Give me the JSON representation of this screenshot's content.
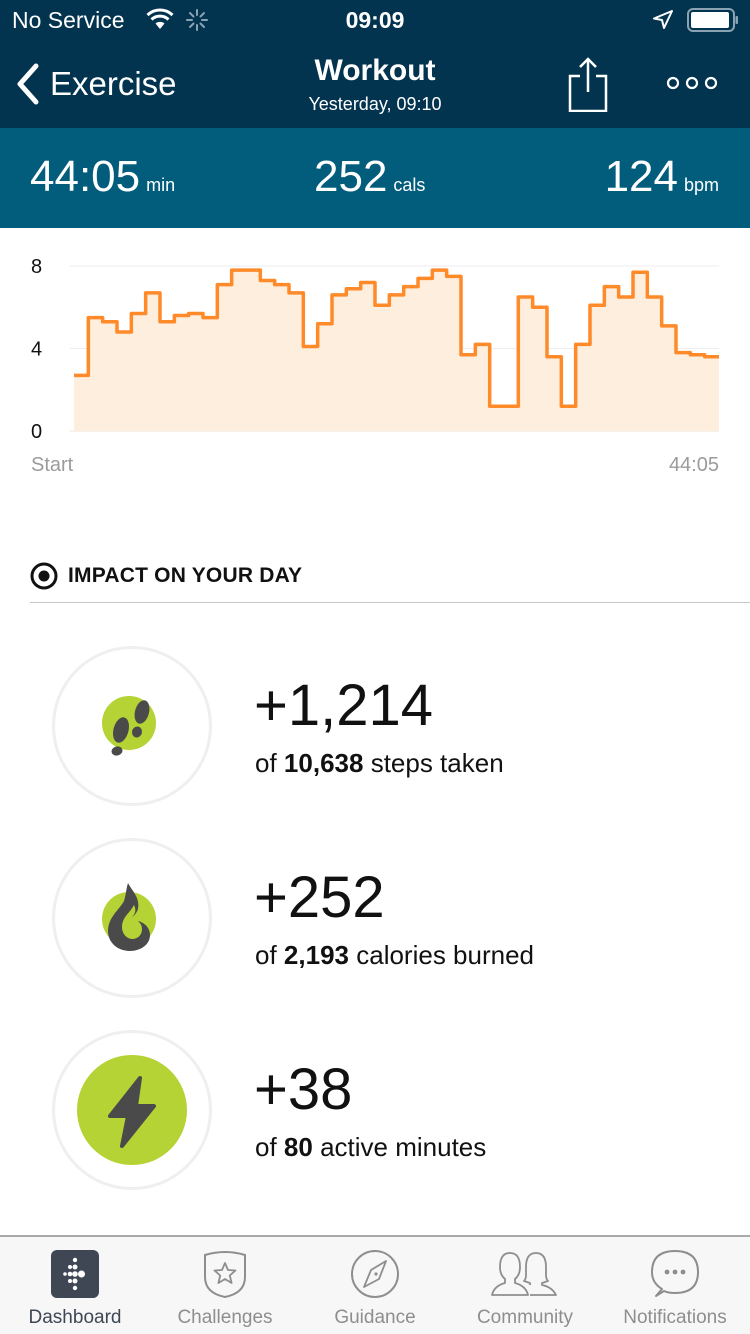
{
  "status_bar": {
    "carrier": "No Service",
    "time": "09:09",
    "icons": [
      "wifi-icon",
      "activity-spinner-icon",
      "location-arrow-icon",
      "battery-icon"
    ]
  },
  "nav": {
    "back_label": "Exercise",
    "title": "Workout",
    "subtitle": "Yesterday, 09:10",
    "share_icon": "share-icon",
    "more_icon": "more-dots-icon"
  },
  "summary": {
    "duration": {
      "value": "44:05",
      "unit": "min"
    },
    "calories": {
      "value": "252",
      "unit": "cals"
    },
    "heart_rate": {
      "value": "124",
      "unit": "bpm"
    }
  },
  "colors": {
    "nav_bg": "#02334f",
    "summary_bg": "#025d7c",
    "chart_line": "#ff8a2a",
    "chart_fill": "#fdeedd",
    "accent_green": "#b5d334",
    "icon_dark": "#4a4a4a"
  },
  "chart_data": {
    "type": "line",
    "step": true,
    "title": "",
    "xlabel": "",
    "ylabel": "",
    "ylim": [
      0,
      8
    ],
    "yticks": [
      "0",
      "4",
      "8"
    ],
    "x_start_label": "Start",
    "x_end_label": "44:05",
    "duration_seconds": 2645,
    "grid": true,
    "values": [
      2.7,
      5.5,
      5.3,
      4.8,
      5.7,
      6.7,
      5.3,
      5.6,
      5.7,
      5.5,
      7.1,
      7.8,
      7.8,
      7.3,
      7.1,
      6.7,
      4.1,
      5.2,
      6.6,
      6.9,
      7.2,
      6.1,
      6.6,
      7.0,
      7.4,
      7.8,
      7.5,
      3.7,
      4.2,
      1.2,
      1.2,
      6.5,
      6.0,
      3.6,
      1.2,
      4.2,
      6.1,
      7.0,
      6.5,
      7.7,
      6.5,
      5.1,
      3.8,
      3.7,
      3.6
    ]
  },
  "impact": {
    "heading": "IMPACT ON YOUR DAY",
    "items": [
      {
        "icon": "footsteps-icon",
        "delta": "+1,214",
        "of": "of",
        "total": "10,638",
        "label": "steps taken"
      },
      {
        "icon": "flame-icon",
        "delta": "+252",
        "of": "of",
        "total": "2,193",
        "label": "calories burned"
      },
      {
        "icon": "lightning-bolt-icon",
        "delta": "+38",
        "of": "of",
        "total": "80",
        "label": "active minutes"
      }
    ]
  },
  "tabbar": {
    "items": [
      {
        "label": "Dashboard",
        "icon": "fitbit-logo-icon",
        "active": true
      },
      {
        "label": "Challenges",
        "icon": "star-badge-icon",
        "active": false
      },
      {
        "label": "Guidance",
        "icon": "compass-icon",
        "active": false
      },
      {
        "label": "Community",
        "icon": "people-icon",
        "active": false
      },
      {
        "label": "Notifications",
        "icon": "chat-bubble-icon",
        "active": false
      }
    ]
  }
}
